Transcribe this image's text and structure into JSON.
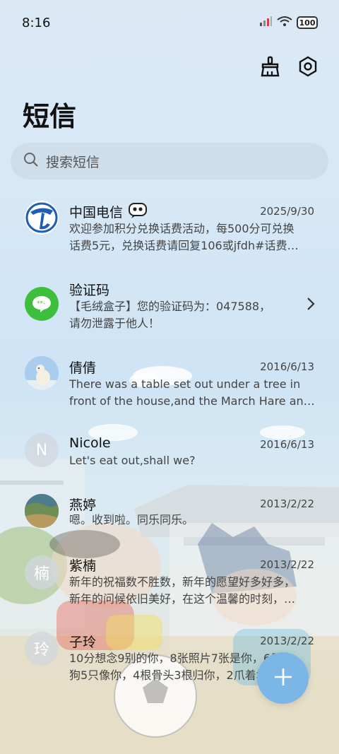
{
  "status_bar": {
    "time": "8:16",
    "battery": "100"
  },
  "page": {
    "title": "短信"
  },
  "search": {
    "placeholder": "搜索短信"
  },
  "conversations": [
    {
      "name": "中国电信",
      "date": "2025/9/30",
      "preview_line1": "欢迎参加积分兑换话费活动，每500分可兑换",
      "preview_line2": "话费5元，兑换话费请回复106或jfdh#话费…",
      "avatar": "china-telecom-logo"
    },
    {
      "name": "验证码",
      "date": "",
      "preview_line1": "【毛绒盒子】您的验证码为：047588，",
      "preview_line2": "请勿泄露于他人！",
      "avatar": "message-bubble-icon"
    },
    {
      "name": "倩倩",
      "date": "2016/6/13",
      "preview_line1": "There was a table set out under a tree in",
      "preview_line2": "front of the house,and the March Hare an…",
      "avatar": "polar-bear-photo"
    },
    {
      "name": "Nicole",
      "date": "2016/6/13",
      "preview_line1": "Let's eat out,shall we?",
      "avatar_letter": "N"
    },
    {
      "name": "燕婷",
      "date": "2013/2/22",
      "preview_line1": "嗯。收到啦。同乐同乐。",
      "avatar": "landscape-photo"
    },
    {
      "name": "紫楠",
      "date": "2013/2/22",
      "preview_line1": "新年的祝福数不胜数，新年的愿望好多好多，",
      "preview_line2": "新年的问候依旧美好，在这个温馨的时刻，…",
      "avatar_letter": "楠"
    },
    {
      "name": "子玲",
      "date": "2013/2/22",
      "preview_line1": "10分想念9别的你，8张照片7张是你，6只小",
      "preview_line2": "狗5只像你，4根骨头3根归你，2爪着地1定…",
      "avatar_letter": "玲"
    }
  ],
  "icons": {
    "clean": "broom-icon",
    "settings": "settings-icon",
    "compose": "plus-icon",
    "search": "search-icon",
    "chevron": "chevron-right-icon",
    "bot": "chatbot-icon"
  },
  "colors": {
    "fab": "#7cb6e6",
    "telecom_blue": "#1e5fb5",
    "verify_green": "#3ebf3c"
  }
}
